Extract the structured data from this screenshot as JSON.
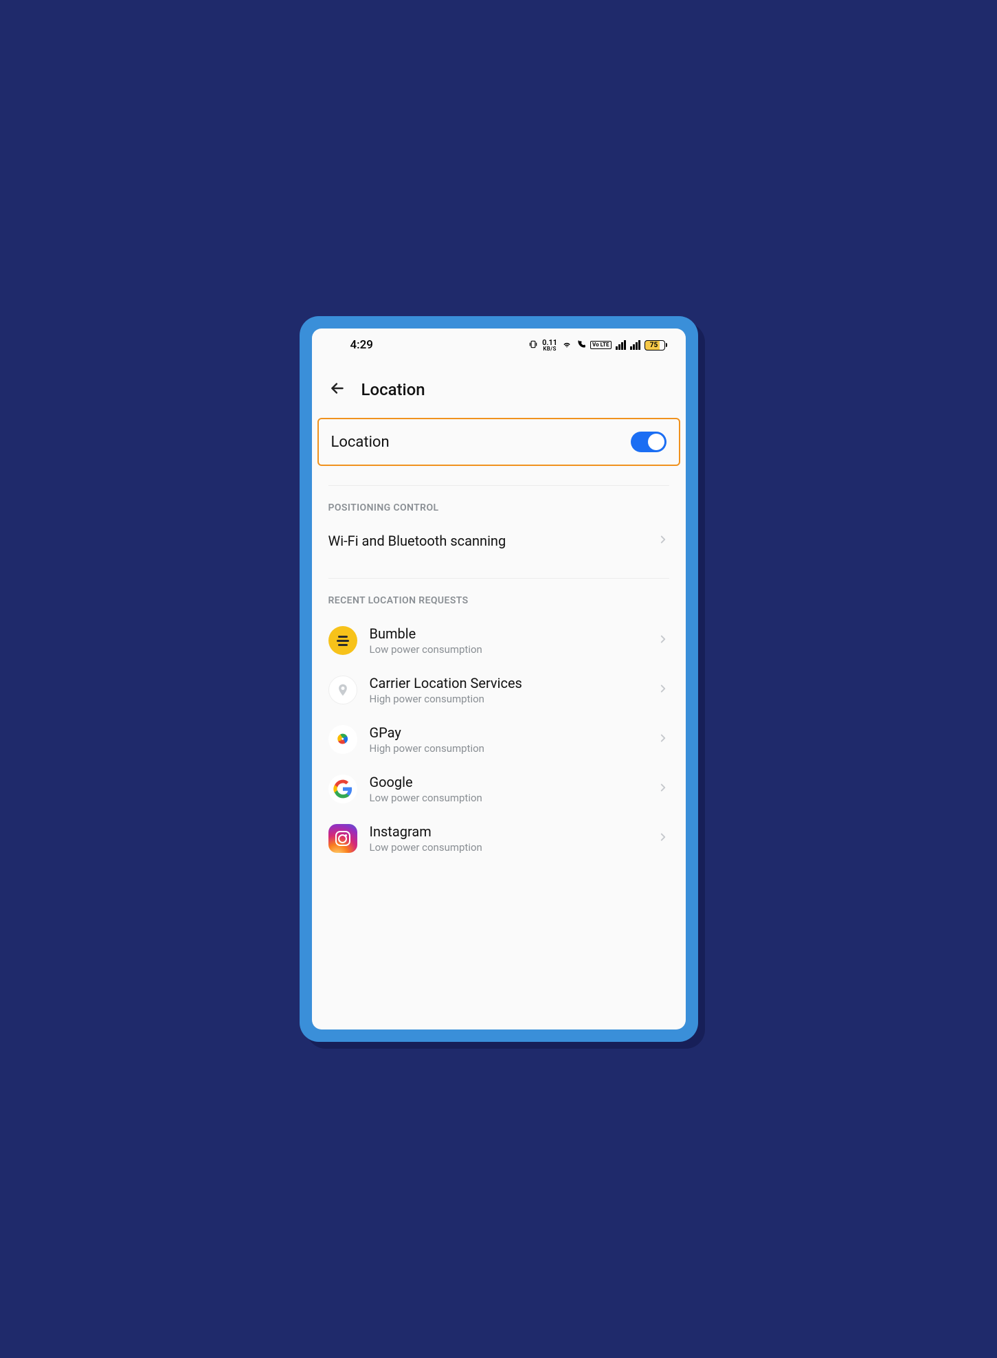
{
  "status_bar": {
    "time": "4:29",
    "net_speed_value": "0.11",
    "net_speed_unit": "KB/S",
    "volte_label": "Vo LTE",
    "battery_level": "75"
  },
  "header": {
    "title": "Location"
  },
  "location_toggle": {
    "label": "Location",
    "on": true
  },
  "sections": {
    "positioning": {
      "header": "POSITIONING CONTROL",
      "items": [
        {
          "title": "Wi-Fi and Bluetooth scanning"
        }
      ]
    },
    "recent": {
      "header": "RECENT LOCATION REQUESTS",
      "items": [
        {
          "icon": "bumble",
          "title": "Bumble",
          "sub": "Low power consumption"
        },
        {
          "icon": "location",
          "title": "Carrier Location Services",
          "sub": "High power consumption"
        },
        {
          "icon": "gpay",
          "title": "GPay",
          "sub": "High power consumption"
        },
        {
          "icon": "google",
          "title": "Google",
          "sub": "Low power consumption"
        },
        {
          "icon": "instagram",
          "title": "Instagram",
          "sub": "Low power consumption"
        }
      ]
    }
  }
}
